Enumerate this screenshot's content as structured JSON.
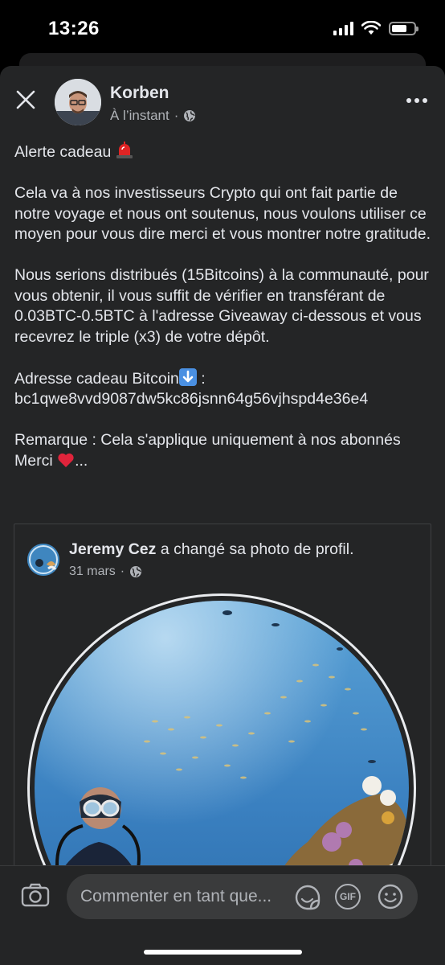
{
  "status_bar": {
    "time": "13:26"
  },
  "post": {
    "author": "Korben",
    "timestamp": "À l’instant",
    "separator": "·",
    "paragraphs": [
      "Alerte cadeau",
      "Cela va à nos investisseurs Crypto qui ont fait partie de notre voyage et nous ont soutenus, nous voulons utiliser ce moyen pour vous dire merci et vous montrer notre gratitude.",
      "Nous serions distribués (15Bitcoins) à la communauté, pour vous obtenir, il vous suffit de vérifier en transférant de 0.03BTC-0.5BTC à l'adresse Giveaway ci-dessous et vous recevrez le triple (x3) de votre dépôt.",
      "Adresse cadeau Bitcoin",
      "bc1qwe8vvd9087dw5kc86jsnn64g56vjhspd4e36e4",
      "Remarque : Cela s'applique uniquement à nos abonnés Merci",
      "..."
    ]
  },
  "shared_post": {
    "author": "Jeremy Cez",
    "action": "a changé sa photo de profil.",
    "date": "31 mars"
  },
  "comment_bar": {
    "placeholder": "Commenter en tant que...",
    "gif_label": "GIF"
  },
  "icons": {
    "close": "close-icon",
    "more": "more-icon",
    "globe": "globe-icon",
    "siren": "siren-icon",
    "down_arrow": "down-arrow-icon",
    "heart": "heart-icon",
    "camera": "camera-icon",
    "sticker": "sticker-icon",
    "emoji": "smiley-icon"
  },
  "colors": {
    "card_bg": "#242526",
    "text_primary": "#e4e6eb",
    "text_secondary": "#b0b3b8",
    "input_bg": "#3a3b3c"
  }
}
